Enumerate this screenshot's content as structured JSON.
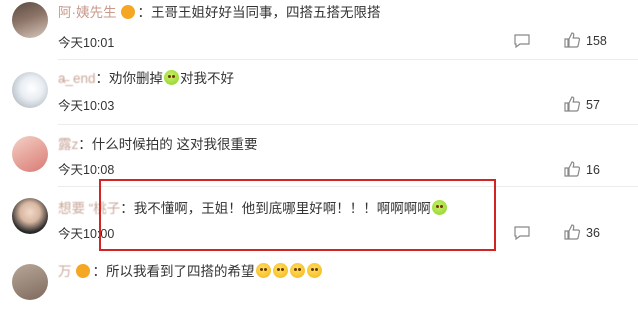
{
  "comments": [
    {
      "name": "阿·姨先生",
      "text": "：王哥王姐好好当同事，四搭五搭无限搭",
      "time": "今天10:01",
      "likes": "158"
    },
    {
      "name": "a̶_end",
      "text": "：劝你删掉",
      "text2": "对我不好",
      "time": "今天10:03",
      "likes": "57"
    },
    {
      "name": "露z",
      "text": "：什么时候拍的 这对我很重要",
      "time": "今天10:08",
      "likes": "16"
    },
    {
      "name": "想要  “桃子",
      "text": "：我不懂啊，王姐！他到底哪里好啊！！！啊啊啊啊",
      "time": "今天10:00",
      "likes": "36"
    },
    {
      "name": "万",
      "text": "：所以我看到了四搭的希望",
      "time": "",
      "likes": ""
    }
  ]
}
